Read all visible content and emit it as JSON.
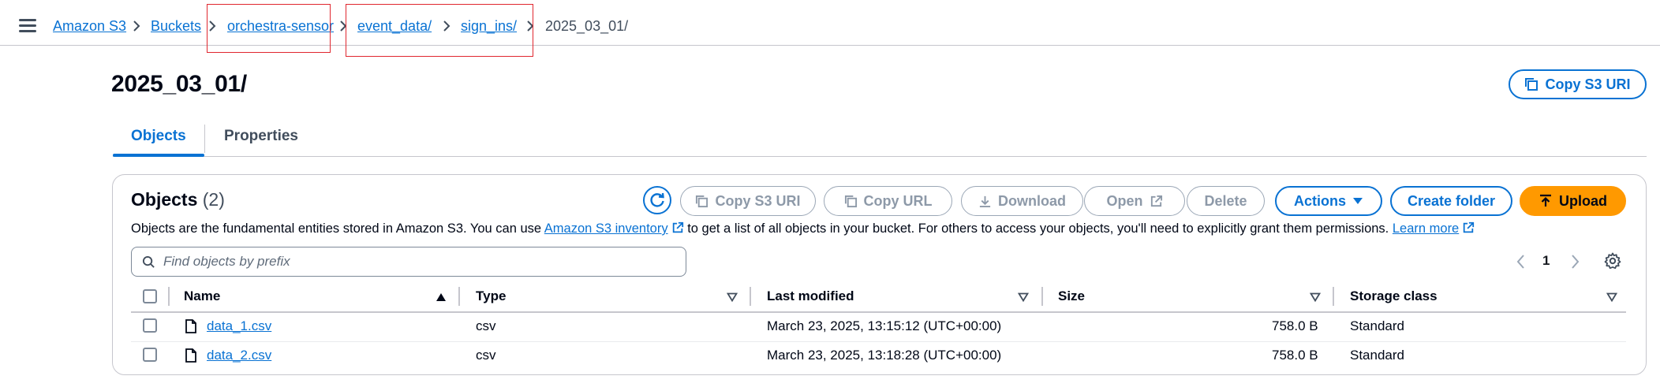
{
  "breadcrumbs": [
    {
      "label": "Amazon S3",
      "link": true
    },
    {
      "label": "Buckets",
      "link": true
    },
    {
      "label": "orchestra-sensor",
      "link": true
    },
    {
      "label": "event_data/",
      "link": true
    },
    {
      "label": "sign_ins/",
      "link": true
    },
    {
      "label": "2025_03_01/",
      "link": false
    }
  ],
  "header": {
    "title": "2025_03_01/",
    "copy_uri_label": "Copy S3 URI"
  },
  "tabs": [
    {
      "label": "Objects",
      "active": true
    },
    {
      "label": "Properties",
      "active": false
    }
  ],
  "objects_panel": {
    "heading": "Objects",
    "count": "(2)",
    "description_prefix": "Objects are the fundamental entities stored in Amazon S3. You can use ",
    "inventory_link": "Amazon S3 inventory",
    "description_middle": " to get a list of all objects in your bucket. For others to access your objects, you'll need to explicitly grant them permissions. ",
    "learn_more": "Learn more",
    "search_placeholder": "Find objects by prefix",
    "page_number": "1"
  },
  "toolbar": {
    "copy_uri": "Copy S3 URI",
    "copy_url": "Copy URL",
    "download": "Download",
    "open": "Open",
    "delete": "Delete",
    "actions": "Actions",
    "create_folder": "Create folder",
    "upload": "Upload"
  },
  "table": {
    "columns": [
      "Name",
      "Type",
      "Last modified",
      "Size",
      "Storage class"
    ],
    "rows": [
      {
        "name": "data_1.csv",
        "type": "csv",
        "last_modified": "March 23, 2025, 13:15:12 (UTC+00:00)",
        "size": "758.0 B",
        "storage_class": "Standard"
      },
      {
        "name": "data_2.csv",
        "type": "csv",
        "last_modified": "March 23, 2025, 13:18:28 (UTC+00:00)",
        "size": "758.0 B",
        "storage_class": "Standard"
      }
    ]
  },
  "colors": {
    "link": "#0972d3",
    "primary": "#ff9900",
    "highlight": "#e0272f",
    "disabled": "#8d99a8"
  }
}
